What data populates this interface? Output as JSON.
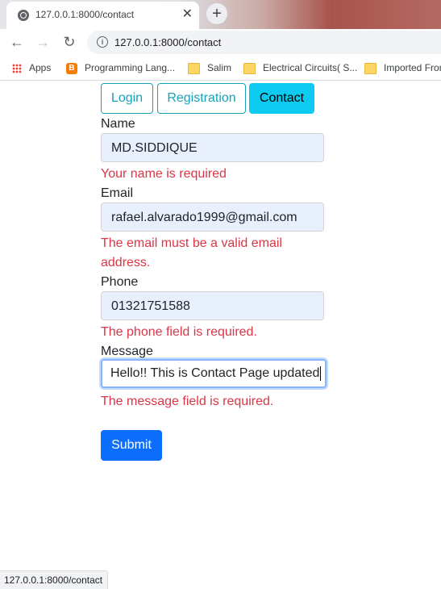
{
  "browser": {
    "tab_title": "127.0.0.1:8000/contact",
    "tab_close": "✕",
    "new_tab": "+",
    "url": "127.0.0.1:8000/contact",
    "back": "←",
    "forward": "→",
    "reload": "↻",
    "bookmarks": [
      "Apps",
      "Programming Lang...",
      "Salim",
      "Electrical Circuits( S...",
      "Imported From"
    ]
  },
  "nav": {
    "login": "Login",
    "registration": "Registration",
    "contact": "Contact"
  },
  "form": {
    "name_label": "Name",
    "name_value": "MD.SIDDIQUE",
    "name_error": "Your name is required",
    "email_label": "Email",
    "email_value": "rafael.alvarado1999@gmail.com",
    "email_error": "The email must be a valid email address.",
    "phone_label": "Phone",
    "phone_value": "01321751588",
    "phone_error": "The phone field is required.",
    "message_label": "Message",
    "message_value": "Hello!! This is Contact Page updated",
    "message_error": "The message field is required.",
    "submit_label": "Submit"
  },
  "status_bar": "127.0.0.1:8000/contact"
}
